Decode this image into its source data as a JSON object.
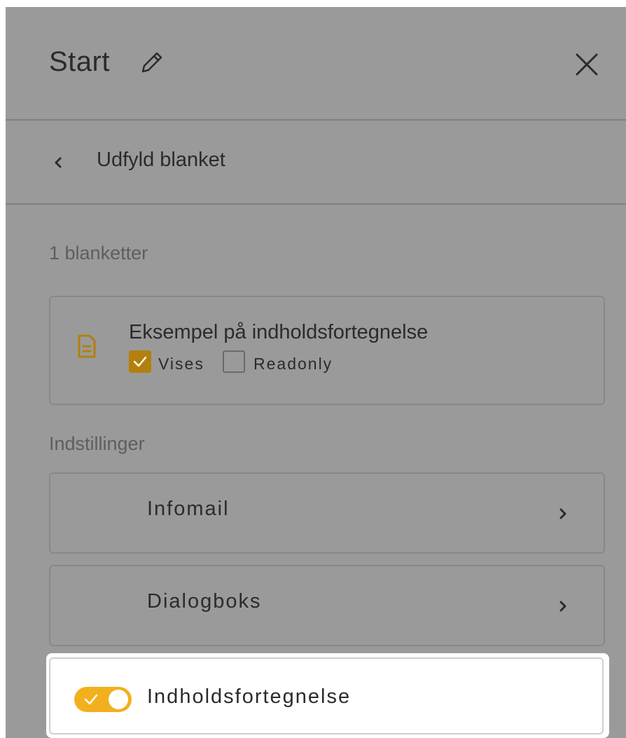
{
  "header": {
    "title": "Start",
    "edit_icon": "pencil-icon",
    "close_icon": "close-icon"
  },
  "nav": {
    "back_icon": "chevron-left-icon",
    "label": "Udfyld blanket"
  },
  "forms": {
    "count_label": "1 blanketter",
    "items": [
      {
        "icon": "document-icon",
        "title": "Eksempel på indholdsfortegnelse",
        "checkboxes": [
          {
            "label": "Vises",
            "checked": true
          },
          {
            "label": "Readonly",
            "checked": false
          }
        ]
      }
    ]
  },
  "settings": {
    "label": "Indstillinger",
    "rows": [
      {
        "label": "Infomail",
        "icon": "chevron-right-icon"
      },
      {
        "label": "Dialogboks",
        "icon": "chevron-right-icon"
      }
    ],
    "toggle_row": {
      "label": "Indholdsfortegnelse",
      "enabled": true
    }
  },
  "colors": {
    "overlay": "#9a9a9a",
    "accent": "#b3800e",
    "toggle_on": "#f2b01e"
  }
}
